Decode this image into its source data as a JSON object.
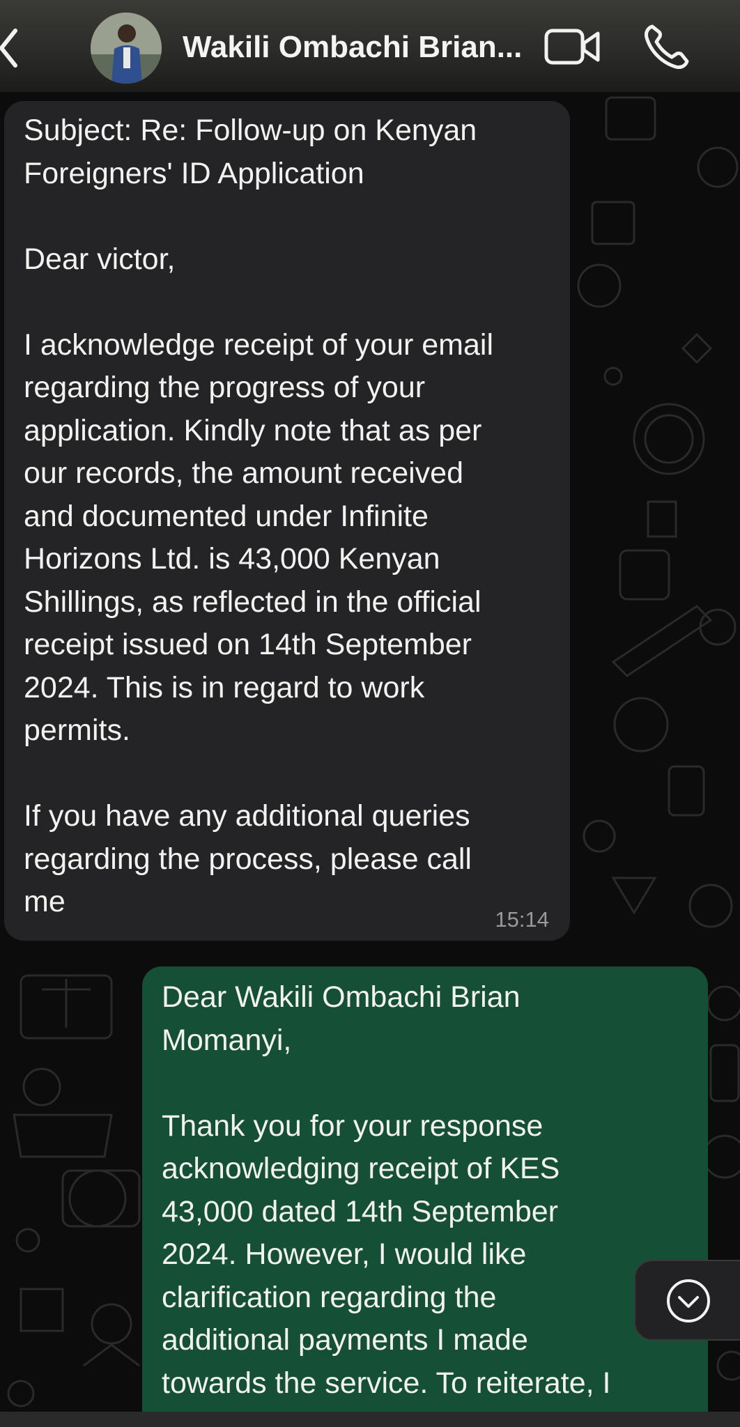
{
  "header": {
    "contact_name": "Wakili Ombachi Brian...",
    "icons": {
      "back": "chevron-left-icon",
      "video": "video-camera-icon",
      "call": "phone-icon"
    }
  },
  "messages": [
    {
      "direction": "incoming",
      "lines": [
        "Subject: Re: Follow-up on Kenyan",
        "Foreigners' ID Application",
        "",
        "Dear victor,",
        "",
        "I acknowledge receipt of your email",
        "regarding the progress of your",
        "application. Kindly note that as per",
        "our records, the amount received",
        "and documented under Infinite",
        "Horizons Ltd. is 43,000 Kenyan",
        "Shillings, as reflected in the official",
        "receipt issued on 14th September",
        "2024. This is in regard to work",
        "permits.",
        "",
        "If you have any additional queries",
        "regarding the process, please call",
        "me"
      ],
      "time": "15:14"
    },
    {
      "direction": "outgoing",
      "lines": [
        "Dear Wakili Ombachi Brian",
        "Momanyi,",
        "",
        "Thank you for your response",
        "acknowledging receipt of KES",
        "43,000 dated 14th September",
        "2024. However, I would like",
        "clarification regarding the",
        "additional payments I made",
        "towards the service. To reiterate, I"
      ]
    }
  ],
  "scroll_button": {
    "icon": "chevron-down-circle-icon"
  },
  "colors": {
    "incoming_bubble": "#242426",
    "outgoing_bubble": "#154f36",
    "header": "#2b2b29",
    "background": "#0c0c0c"
  }
}
